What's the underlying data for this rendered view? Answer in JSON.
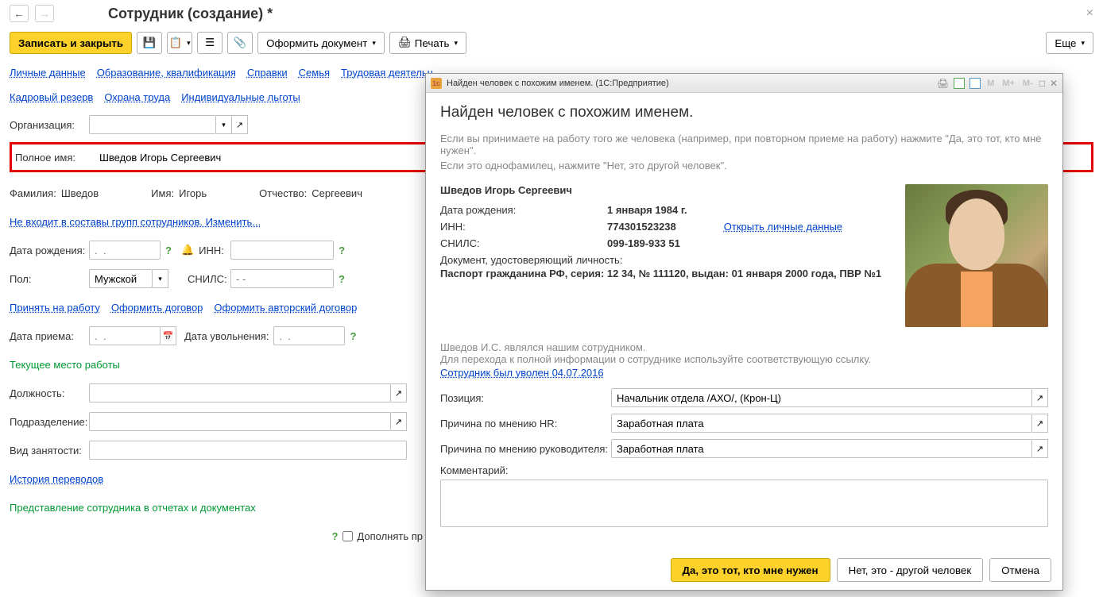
{
  "page": {
    "title": "Сотрудник (создание) *"
  },
  "toolbar": {
    "save_close": "Записать и закрыть",
    "format_doc": "Оформить документ",
    "print": "Печать",
    "more": "Еще"
  },
  "tabs": {
    "t1": "Личные данные",
    "t2": "Образование, квалификация",
    "t3": "Справки",
    "t4": "Семья",
    "t5": "Трудовая деятельн",
    "t6": "Кадровый резерв",
    "t7": "Охрана труда",
    "t8": "Индивидуальные льготы"
  },
  "labels": {
    "org": "Организация:",
    "fullname": "Полное имя:",
    "surname": "Фамилия:",
    "name": "Имя:",
    "patronymic": "Отчество:",
    "groups_link": "Не входит в составы групп сотрудников. Изменить...",
    "dob": "Дата рождения:",
    "inn": "ИНН:",
    "sex": "Пол:",
    "snils": "СНИЛС:",
    "hire_link": "Принять на работу",
    "contract_link": "Оформить договор",
    "author_link": "Оформить авторский договор",
    "hire_date": "Дата приема:",
    "fire_date": "Дата увольнения:",
    "current_job": "Текущее место работы",
    "position": "Должность:",
    "subdivision": "Подразделение:",
    "employment_type": "Вид занятости:",
    "transfers_link": "История переводов",
    "representation": "Представление сотрудника в отчетах и документах",
    "supplement": "Дополнять пр"
  },
  "values": {
    "fullname": "Шведов Игорь Сергеевич",
    "surname": "Шведов",
    "name": "Игорь",
    "patronymic": "Сергеевич",
    "sex": "Мужской",
    "dob_placeholder": ".  .",
    "snils_placeholder": "- -",
    "datep": ".  ."
  },
  "modal": {
    "window_title": "Найден человек с похожим именем.  (1С:Предприятие)",
    "heading": "Найден человек с похожим именем.",
    "intro1": "Если вы принимаете на работу того же человека (например, при повторном приеме на работу) нажмите \"Да, это тот, кто мне нужен\".",
    "intro2": "Если это однофамилец, нажмите \"Нет, это другой человек\".",
    "person_name": "Шведов Игорь Сергеевич",
    "dob_label": "Дата рождения:",
    "dob_value": "1 января 1984 г.",
    "inn_label": "ИНН:",
    "inn_value": "774301523238",
    "open_personal": "Открыть личные данные",
    "snils_label": "СНИЛС:",
    "snils_value": "099-189-933 51",
    "doc_label": "Документ, удостоверяющий личность:",
    "doc_value": "Паспорт гражданина РФ, серия: 12 34, № 111120, выдан: 01 января 2000 года, ПВР №1",
    "was_employee": "Шведов И.С. являлся нашим сотрудником.",
    "goto_info": "Для перехода к полной информации о сотруднике используйте соответствующую ссылку.",
    "fired_link": "Сотрудник был уволен 04.07.2016",
    "position_label": "Позиция:",
    "position_value": "Начальник отдела /АХО/, (Крон-Ц)",
    "reason_hr_label": "Причина по мнению HR:",
    "reason_hr_value": "Заработная плата",
    "reason_mgr_label": "Причина по мнению руководителя:",
    "reason_mgr_value": "Заработная плата",
    "comment_label": "Комментарий:",
    "btn_yes": "Да, это тот, кто мне нужен",
    "btn_no": "Нет, это - другой человек",
    "btn_cancel": "Отмена",
    "m": "M",
    "m_plus": "M+",
    "m_minus": "M-"
  }
}
